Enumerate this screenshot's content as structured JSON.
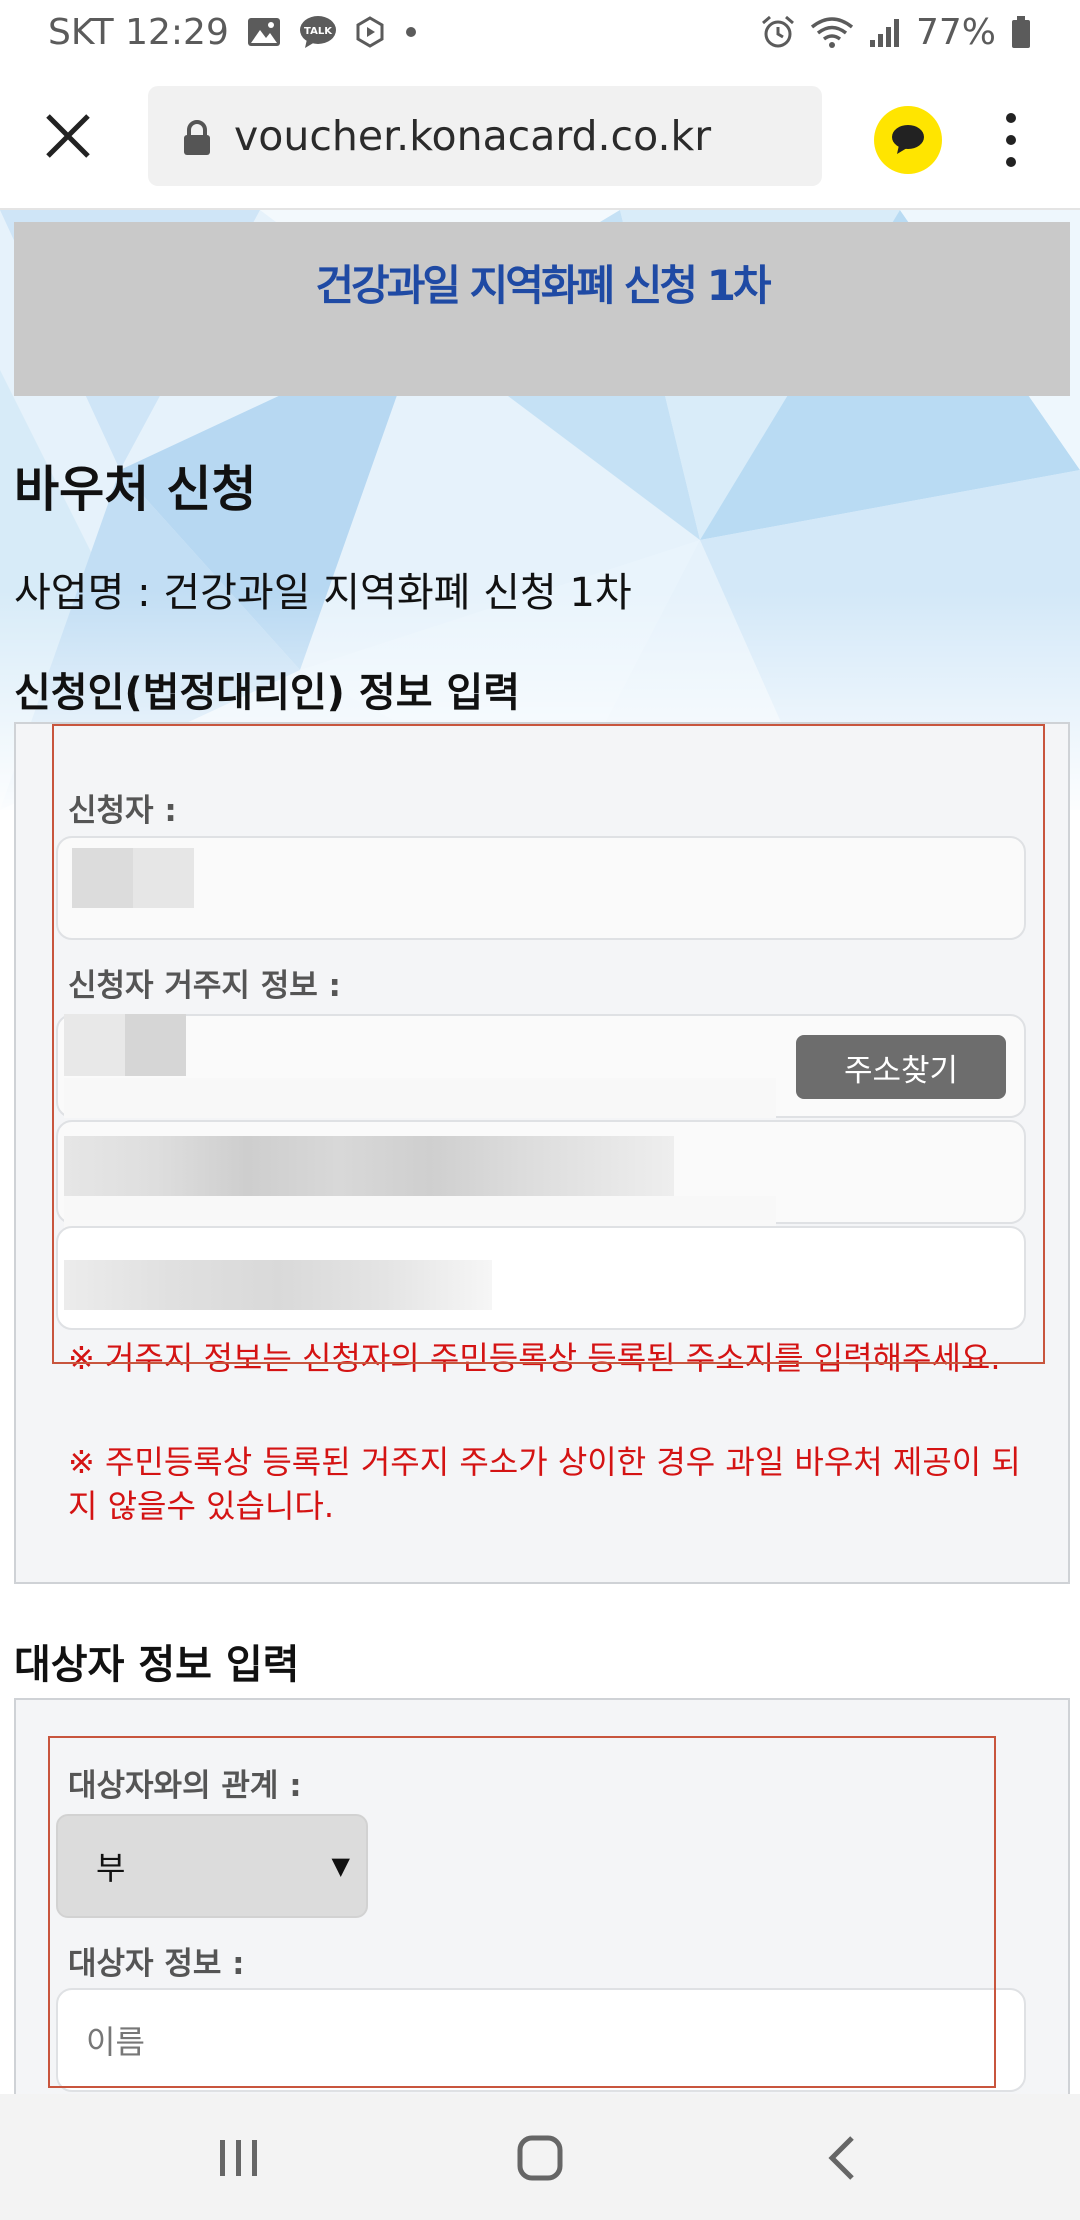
{
  "status_bar": {
    "carrier_time": "SKT 12:29",
    "talk_badge": "TALK",
    "battery": "77%",
    "icons": [
      "gallery-icon",
      "talk-icon",
      "shield-icon",
      "dot-icon",
      "alarm-icon",
      "wifi-icon",
      "signal-icon",
      "battery-icon"
    ]
  },
  "browser": {
    "url": "voucher.konacard.co.kr",
    "icons": [
      "close-icon",
      "lock-icon",
      "kakaotalk-icon",
      "more-vert-icon"
    ]
  },
  "colors": {
    "banner_bg": "#c9c9c9",
    "banner_text": "#1f4aa4",
    "notice_red": "#d41313",
    "button_gray": "#6d6d6d",
    "frame_red": "#c8553d",
    "talk_yellow": "#ffe500"
  },
  "page": {
    "banner_title": "건강과일 지역화폐 신청 1차",
    "heading": "바우처 신청",
    "business_name": "사업명 : 건강과일 지역화폐 신청 1차",
    "applicant_section": {
      "title": "신청인(법정대리인) 정보 입력",
      "applicant_label": "신청자 :",
      "address_label": "신청자 거주지 정보 :",
      "address_button": "주소찾기",
      "notice_1": "※ 거주지 정보는 신청자의 주민등록상 등록된 주소지를 입력해주세요.",
      "notice_2": "※ 주민등록상 등록된 거주지 주소가 상이한 경우 과일 바우처 제공이 되지 않을수 있습니다."
    },
    "target_section": {
      "title": "대상자 정보 입력",
      "relation_label": "대상자와의 관계 :",
      "relation_value": "부",
      "relation_arrow": "▼",
      "info_label": "대상자 정보 :",
      "name_placeholder": "이름"
    }
  },
  "nav_bar": {
    "icons": [
      "recent-apps-icon",
      "home-icon",
      "back-icon"
    ]
  }
}
